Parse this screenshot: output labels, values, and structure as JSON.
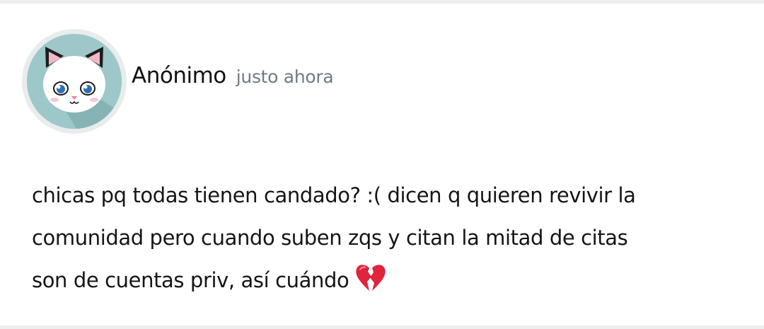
{
  "post": {
    "author": "Anónimo",
    "timestamp": "justo ahora",
    "avatar_icon": "white-cat-icon",
    "body_lines": [
      "chicas pq todas tienen candado? :( dicen q quieren revivir la",
      "comunidad pero cuando suben zqs y citan la mitad de citas",
      "son de cuentas priv, así cuándo"
    ],
    "trailing_emoji": "broken-heart-icon"
  },
  "colors": {
    "background": "#ffffff",
    "divider": "#eeeeee",
    "avatar_ring": "#e9ecec",
    "avatar_bg": "#9dc7c8",
    "text_primary": "#151515",
    "text_secondary": "#6f7a86",
    "broken_heart": "#e0243c"
  }
}
